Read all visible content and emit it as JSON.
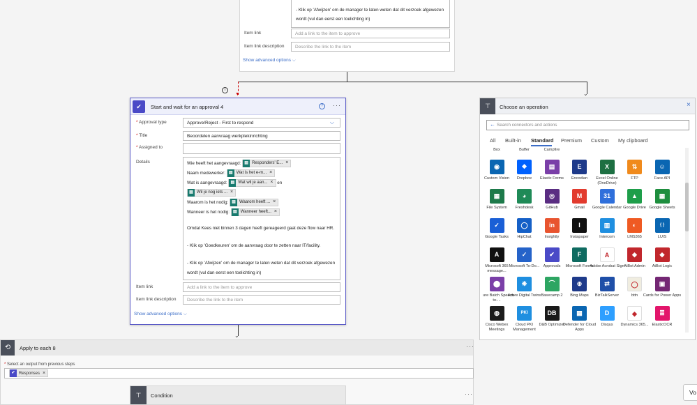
{
  "top_card": {
    "details_last_line1": "- Klik op 'Afwijzen' om de manager te laten weten dat dit verzoek afgewezen",
    "details_last_line2": "wordt (vul dan eerst een toelichting in)",
    "item_link_label": "Item link",
    "item_link_placeholder": "Add a link to the item to approve",
    "item_link_desc_label": "Item link description",
    "item_link_desc_placeholder": "Describe the link to the item",
    "show_advanced": "Show advanced options"
  },
  "approval_card": {
    "title": "Start and wait for an approval 4",
    "approval_type_label": "Approval type",
    "approval_type_value": "Approve/Reject - First to respond",
    "title_label": "Title",
    "title_value": "Beoordelen aanvraag werkplekinrichting",
    "assigned_label": "Assigned to",
    "details_label": "Details",
    "details": {
      "l1_text": "Wie heeft het aangevraagd:",
      "l1_token": "Responders' E...",
      "l2_text": "Naam medewerker:",
      "l2_token": "Wat is het e-m...",
      "l3_text": "Wat is aangevraagd:",
      "l3_token": "Wat wil je aan...",
      "l3_after": "en",
      "l4_token": "Wil je nog iets ...",
      "l5_text": "Waarom is het nodig:",
      "l5_token": "Waarom heeft ...",
      "l6_text": "Wanneer is het nodig:",
      "l6_token": "Wanneer heeft...",
      "p1": "Omdat Kees niet binnen 3 dagen heeft gereageerd gaat deze flow naar HR.",
      "p2": "- Klik op 'Goedkeuren' om de aanvraag door te zetten naar IT/facility.",
      "p3a": "- Klik op 'Afwijzen' om de manager te laten weten dat dit verzoek afgewezen",
      "p3b": "wordt (vul dan eerst een toelichting in)"
    },
    "item_link_label": "Item link",
    "item_link_placeholder": "Add a link to the item to approve",
    "item_link_desc_label": "Item link description",
    "item_link_desc_placeholder": "Describe the link to the item",
    "show_advanced": "Show advanced options"
  },
  "apply_each": {
    "title": "Apply to each 8",
    "select_label": "Select an output from previous steps",
    "token": "Responses"
  },
  "condition": {
    "title": "Condition"
  },
  "operation_panel": {
    "title": "Choose an operation",
    "search_placeholder": "Search connectors and actions",
    "tabs": [
      "All",
      "Built-in",
      "Standard",
      "Premium",
      "Custom",
      "My clipboard"
    ],
    "partial_row": [
      "Box",
      "Buffer",
      "Campfire",
      "Cognito Forms",
      "Computer Vision API",
      "Content Conversion",
      "Content Moderator"
    ],
    "connectors": [
      {
        "name": "Custom Vision",
        "color": "#0a66b2",
        "glyph": "◉"
      },
      {
        "name": "Dropbox",
        "color": "#0061fe",
        "glyph": "❖"
      },
      {
        "name": "Elastic Forms",
        "color": "#7a3fa8",
        "glyph": "▤"
      },
      {
        "name": "Encodian",
        "color": "#1e3a8a",
        "glyph": "E"
      },
      {
        "name": "Excel Online (OneDrive)",
        "color": "#1d6f42",
        "glyph": "X"
      },
      {
        "name": "FTP",
        "color": "#f08a1c",
        "glyph": "⇅"
      },
      {
        "name": "Face API",
        "color": "#0a66b2",
        "glyph": "☺"
      },
      {
        "name": "File System",
        "color": "#1d7a4a",
        "glyph": "▦"
      },
      {
        "name": "Freshdesk",
        "color": "#1f8a57",
        "glyph": "◕"
      },
      {
        "name": "GitHub",
        "color": "#5a2d82",
        "glyph": "◎"
      },
      {
        "name": "Gmail",
        "color": "#e23b2e",
        "glyph": "M"
      },
      {
        "name": "Google Calendar",
        "color": "#2f6fdb",
        "glyph": "31"
      },
      {
        "name": "Google Drive",
        "color": "#1e9e4a",
        "glyph": "▲"
      },
      {
        "name": "Google Sheets",
        "color": "#1e8e3e",
        "glyph": "▦"
      },
      {
        "name": "Google Tasks",
        "color": "#1a5fd6",
        "glyph": "✓"
      },
      {
        "name": "HipChat",
        "color": "#1560c7",
        "glyph": "◯"
      },
      {
        "name": "Insightly",
        "color": "#e8542f",
        "glyph": "in"
      },
      {
        "name": "Instapaper",
        "color": "#111111",
        "glyph": "I"
      },
      {
        "name": "Intercom",
        "color": "#1f8fe0",
        "glyph": "▥"
      },
      {
        "name": "LMS365",
        "color": "#ef5a23",
        "glyph": "◐"
      },
      {
        "name": "LUIS",
        "color": "#0a66b2",
        "glyph": "{ }"
      },
      {
        "name": "Microsoft 365 message...",
        "color": "#111111",
        "glyph": "A"
      },
      {
        "name": "Microsoft To-Do...",
        "color": "#2563c9",
        "glyph": "✓"
      },
      {
        "name": "Approvals",
        "color": "#4a4ac7",
        "glyph": "✔"
      },
      {
        "name": "Microsoft Forms",
        "color": "#0f6b61",
        "glyph": "F"
      },
      {
        "name": "Adobe Acrobat Sign",
        "color": "#ffffff",
        "glyph": "A"
      },
      {
        "name": "AtBot Admin",
        "color": "#c1272d",
        "glyph": "◆"
      },
      {
        "name": "AtBot Logic",
        "color": "#c1272d",
        "glyph": "◆"
      },
      {
        "name": "Azure Batch Speech-to-...",
        "color": "#7b3fa8",
        "glyph": "⬤"
      },
      {
        "name": "Azure Digital Twins",
        "color": "#1f8fe0",
        "glyph": "❋"
      },
      {
        "name": "Basecamp 2",
        "color": "#2da562",
        "glyph": "⌒"
      },
      {
        "name": "Bing Maps",
        "color": "#1e3a8a",
        "glyph": "⊕"
      },
      {
        "name": "BizTalkServer",
        "color": "#1f4fa8",
        "glyph": "⇄"
      },
      {
        "name": "bttn",
        "color": "#f0ede0",
        "glyph": "◯"
      },
      {
        "name": "Cards for Power Apps",
        "color": "#742774",
        "glyph": "▣"
      },
      {
        "name": "Cisco Webex Meetings",
        "color": "#1c1c1c",
        "glyph": "◍"
      },
      {
        "name": "Cloud PKI Management",
        "color": "#1f8fe0",
        "glyph": "PKI"
      },
      {
        "name": "D&B Optimizer",
        "color": "#1a1a1a",
        "glyph": "DB"
      },
      {
        "name": "Defender for Cloud Apps",
        "color": "#0a66b2",
        "glyph": "▦"
      },
      {
        "name": "Disqus",
        "color": "#2e9fff",
        "glyph": "D"
      },
      {
        "name": "Dynamics 365...",
        "color": "#ffffff",
        "glyph": "◆"
      },
      {
        "name": "ElasticOCR",
        "color": "#e3156b",
        "glyph": "≣"
      }
    ],
    "next_row_colors": [
      "#2da562",
      "#4a4ac7",
      "#5a2d82",
      "#dde8f6",
      "#1f8fe0",
      "#f0a800",
      "#1e3a8a"
    ]
  },
  "corner_button": "Vo",
  "colors": {
    "accent": "#5a5ac7",
    "approval_header": "#eef0fb",
    "token_teal": "#187a6e"
  }
}
